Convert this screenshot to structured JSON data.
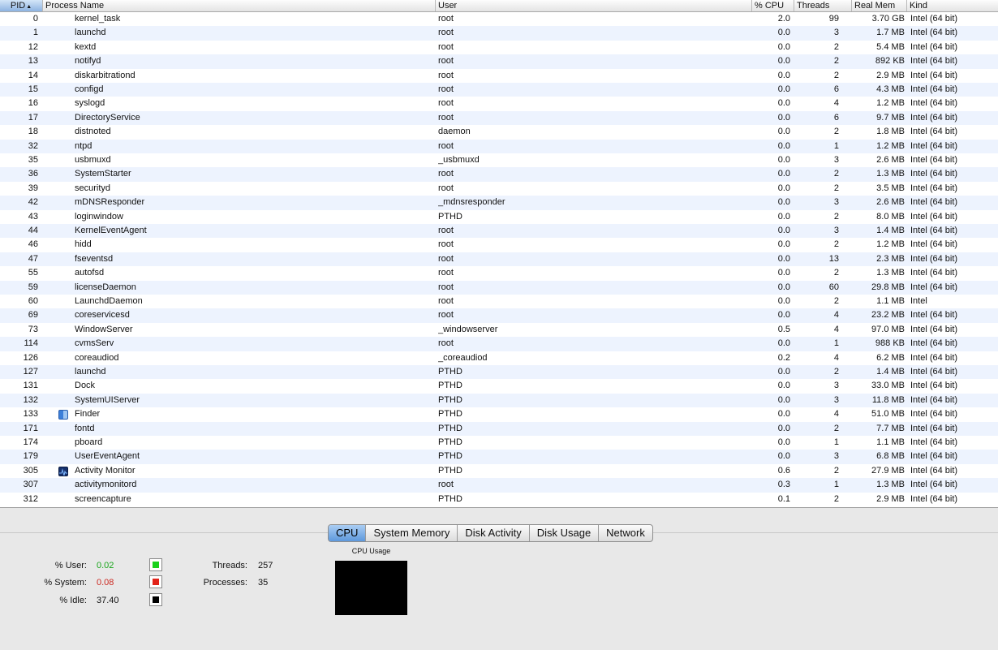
{
  "columns": {
    "pid": "PID",
    "sort_arrow": "▲",
    "process_name": "Process Name",
    "user": "User",
    "cpu": "% CPU",
    "threads": "Threads",
    "real_mem": "Real Mem",
    "kind": "Kind"
  },
  "processes": [
    {
      "pid": "0",
      "name": "kernel_task",
      "user": "root",
      "cpu": "2.0",
      "threads": "99",
      "mem": "3.70 GB",
      "kind": "Intel (64 bit)"
    },
    {
      "pid": "1",
      "name": "launchd",
      "user": "root",
      "cpu": "0.0",
      "threads": "3",
      "mem": "1.7 MB",
      "kind": "Intel (64 bit)"
    },
    {
      "pid": "12",
      "name": "kextd",
      "user": "root",
      "cpu": "0.0",
      "threads": "2",
      "mem": "5.4 MB",
      "kind": "Intel (64 bit)"
    },
    {
      "pid": "13",
      "name": "notifyd",
      "user": "root",
      "cpu": "0.0",
      "threads": "2",
      "mem": "892 KB",
      "kind": "Intel (64 bit)"
    },
    {
      "pid": "14",
      "name": "diskarbitrationd",
      "user": "root",
      "cpu": "0.0",
      "threads": "2",
      "mem": "2.9 MB",
      "kind": "Intel (64 bit)"
    },
    {
      "pid": "15",
      "name": "configd",
      "user": "root",
      "cpu": "0.0",
      "threads": "6",
      "mem": "4.3 MB",
      "kind": "Intel (64 bit)"
    },
    {
      "pid": "16",
      "name": "syslogd",
      "user": "root",
      "cpu": "0.0",
      "threads": "4",
      "mem": "1.2 MB",
      "kind": "Intel (64 bit)"
    },
    {
      "pid": "17",
      "name": "DirectoryService",
      "user": "root",
      "cpu": "0.0",
      "threads": "6",
      "mem": "9.7 MB",
      "kind": "Intel (64 bit)"
    },
    {
      "pid": "18",
      "name": "distnoted",
      "user": "daemon",
      "cpu": "0.0",
      "threads": "2",
      "mem": "1.8 MB",
      "kind": "Intel (64 bit)"
    },
    {
      "pid": "32",
      "name": "ntpd",
      "user": "root",
      "cpu": "0.0",
      "threads": "1",
      "mem": "1.2 MB",
      "kind": "Intel (64 bit)"
    },
    {
      "pid": "35",
      "name": "usbmuxd",
      "user": "_usbmuxd",
      "cpu": "0.0",
      "threads": "3",
      "mem": "2.6 MB",
      "kind": "Intel (64 bit)"
    },
    {
      "pid": "36",
      "name": "SystemStarter",
      "user": "root",
      "cpu": "0.0",
      "threads": "2",
      "mem": "1.3 MB",
      "kind": "Intel (64 bit)"
    },
    {
      "pid": "39",
      "name": "securityd",
      "user": "root",
      "cpu": "0.0",
      "threads": "2",
      "mem": "3.5 MB",
      "kind": "Intel (64 bit)"
    },
    {
      "pid": "42",
      "name": "mDNSResponder",
      "user": "_mdnsresponder",
      "cpu": "0.0",
      "threads": "3",
      "mem": "2.6 MB",
      "kind": "Intel (64 bit)"
    },
    {
      "pid": "43",
      "name": "loginwindow",
      "user": "PTHD",
      "cpu": "0.0",
      "threads": "2",
      "mem": "8.0 MB",
      "kind": "Intel (64 bit)"
    },
    {
      "pid": "44",
      "name": "KernelEventAgent",
      "user": "root",
      "cpu": "0.0",
      "threads": "3",
      "mem": "1.4 MB",
      "kind": "Intel (64 bit)"
    },
    {
      "pid": "46",
      "name": "hidd",
      "user": "root",
      "cpu": "0.0",
      "threads": "2",
      "mem": "1.2 MB",
      "kind": "Intel (64 bit)"
    },
    {
      "pid": "47",
      "name": "fseventsd",
      "user": "root",
      "cpu": "0.0",
      "threads": "13",
      "mem": "2.3 MB",
      "kind": "Intel (64 bit)"
    },
    {
      "pid": "55",
      "name": "autofsd",
      "user": "root",
      "cpu": "0.0",
      "threads": "2",
      "mem": "1.3 MB",
      "kind": "Intel (64 bit)"
    },
    {
      "pid": "59",
      "name": "licenseDaemon",
      "user": "root",
      "cpu": "0.0",
      "threads": "60",
      "mem": "29.8 MB",
      "kind": "Intel (64 bit)"
    },
    {
      "pid": "60",
      "name": "LaunchdDaemon",
      "user": "root",
      "cpu": "0.0",
      "threads": "2",
      "mem": "1.1 MB",
      "kind": "Intel"
    },
    {
      "pid": "69",
      "name": "coreservicesd",
      "user": "root",
      "cpu": "0.0",
      "threads": "4",
      "mem": "23.2 MB",
      "kind": "Intel (64 bit)"
    },
    {
      "pid": "73",
      "name": "WindowServer",
      "user": "_windowserver",
      "cpu": "0.5",
      "threads": "4",
      "mem": "97.0 MB",
      "kind": "Intel (64 bit)"
    },
    {
      "pid": "114",
      "name": "cvmsServ",
      "user": "root",
      "cpu": "0.0",
      "threads": "1",
      "mem": "988 KB",
      "kind": "Intel (64 bit)"
    },
    {
      "pid": "126",
      "name": "coreaudiod",
      "user": "_coreaudiod",
      "cpu": "0.2",
      "threads": "4",
      "mem": "6.2 MB",
      "kind": "Intel (64 bit)"
    },
    {
      "pid": "127",
      "name": "launchd",
      "user": "PTHD",
      "cpu": "0.0",
      "threads": "2",
      "mem": "1.4 MB",
      "kind": "Intel (64 bit)"
    },
    {
      "pid": "131",
      "name": "Dock",
      "user": "PTHD",
      "cpu": "0.0",
      "threads": "3",
      "mem": "33.0 MB",
      "kind": "Intel (64 bit)"
    },
    {
      "pid": "132",
      "name": "SystemUIServer",
      "user": "PTHD",
      "cpu": "0.0",
      "threads": "3",
      "mem": "11.8 MB",
      "kind": "Intel (64 bit)"
    },
    {
      "pid": "133",
      "name": "Finder",
      "user": "PTHD",
      "cpu": "0.0",
      "threads": "4",
      "mem": "51.0 MB",
      "kind": "Intel (64 bit)",
      "icon": "finder-icon"
    },
    {
      "pid": "171",
      "name": "fontd",
      "user": "PTHD",
      "cpu": "0.0",
      "threads": "2",
      "mem": "7.7 MB",
      "kind": "Intel (64 bit)"
    },
    {
      "pid": "174",
      "name": "pboard",
      "user": "PTHD",
      "cpu": "0.0",
      "threads": "1",
      "mem": "1.1 MB",
      "kind": "Intel (64 bit)"
    },
    {
      "pid": "179",
      "name": "UserEventAgent",
      "user": "PTHD",
      "cpu": "0.0",
      "threads": "3",
      "mem": "6.8 MB",
      "kind": "Intel (64 bit)"
    },
    {
      "pid": "305",
      "name": "Activity Monitor",
      "user": "PTHD",
      "cpu": "0.6",
      "threads": "2",
      "mem": "27.9 MB",
      "kind": "Intel (64 bit)",
      "icon": "activity-monitor-icon"
    },
    {
      "pid": "307",
      "name": "activitymonitord",
      "user": "root",
      "cpu": "0.3",
      "threads": "1",
      "mem": "1.3 MB",
      "kind": "Intel (64 bit)"
    },
    {
      "pid": "312",
      "name": "screencapture",
      "user": "PTHD",
      "cpu": "0.1",
      "threads": "2",
      "mem": "2.9 MB",
      "kind": "Intel (64 bit)"
    }
  ],
  "tabs": [
    "CPU",
    "System Memory",
    "Disk Activity",
    "Disk Usage",
    "Network"
  ],
  "active_tab": "CPU",
  "cpu_stats": {
    "user_label": "% User:",
    "user_value": "0.02",
    "system_label": "% System:",
    "system_value": "0.08",
    "idle_label": "% Idle:",
    "idle_value": "37.40",
    "threads_label": "Threads:",
    "threads_value": "257",
    "processes_label": "Processes:",
    "processes_value": "35",
    "graph_title": "CPU Usage"
  },
  "colors": {
    "user": "#19d11c",
    "system": "#e2231a",
    "idle": "#000000",
    "row_alt": "#edf3fe",
    "tab_active": "#5d98dc"
  }
}
